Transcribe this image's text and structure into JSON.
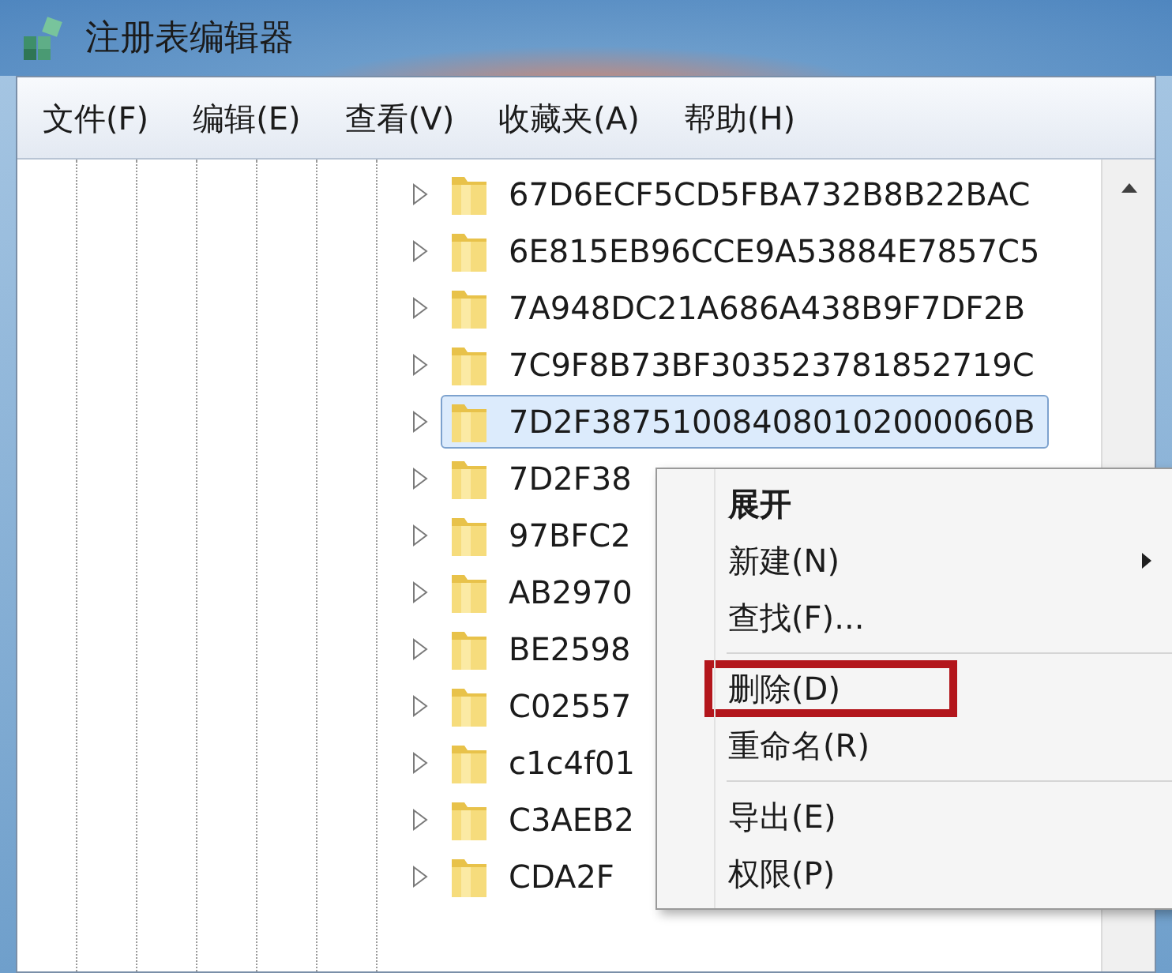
{
  "window": {
    "title": "注册表编辑器"
  },
  "menu_bar": [
    {
      "label": "文件(F)"
    },
    {
      "label": "编辑(E)"
    },
    {
      "label": "查看(V)"
    },
    {
      "label": "收藏夹(A)"
    },
    {
      "label": "帮助(H)"
    }
  ],
  "tree": {
    "rows": [
      {
        "label": "67D6ECF5CD5FBA732B8B22BAC",
        "selected": false
      },
      {
        "label": "6E815EB96CCE9A53884E7857C5",
        "selected": false
      },
      {
        "label": "7A948DC21A686A438B9F7DF2B",
        "selected": false
      },
      {
        "label": "7C9F8B73BF303523781852719C",
        "selected": false
      },
      {
        "label": "7D2F387510084080102000060B",
        "selected": true
      },
      {
        "label": "7D2F38",
        "selected": false
      },
      {
        "label": "97BFC2",
        "selected": false
      },
      {
        "label": "AB2970",
        "selected": false
      },
      {
        "label": "BE2598",
        "selected": false
      },
      {
        "label": "C02557",
        "selected": false
      },
      {
        "label": "c1c4f01",
        "selected": false
      },
      {
        "label": "C3AEB2",
        "selected": false
      },
      {
        "label": "CDA2F",
        "selected": false
      }
    ]
  },
  "context_menu": {
    "items": [
      {
        "kind": "item",
        "label": "展开",
        "bold": true,
        "submenu": false,
        "outlined": false
      },
      {
        "kind": "item",
        "label": "新建(N)",
        "bold": false,
        "submenu": true,
        "outlined": false
      },
      {
        "kind": "item",
        "label": "查找(F)...",
        "bold": false,
        "submenu": false,
        "outlined": false
      },
      {
        "kind": "separator"
      },
      {
        "kind": "item",
        "label": "删除(D)",
        "bold": false,
        "submenu": false,
        "outlined": true
      },
      {
        "kind": "item",
        "label": "重命名(R)",
        "bold": false,
        "submenu": false,
        "outlined": false
      },
      {
        "kind": "separator"
      },
      {
        "kind": "item",
        "label": "导出(E)",
        "bold": false,
        "submenu": false,
        "outlined": false
      },
      {
        "kind": "item",
        "label": "权限(P)",
        "bold": false,
        "submenu": false,
        "outlined": false
      }
    ]
  }
}
